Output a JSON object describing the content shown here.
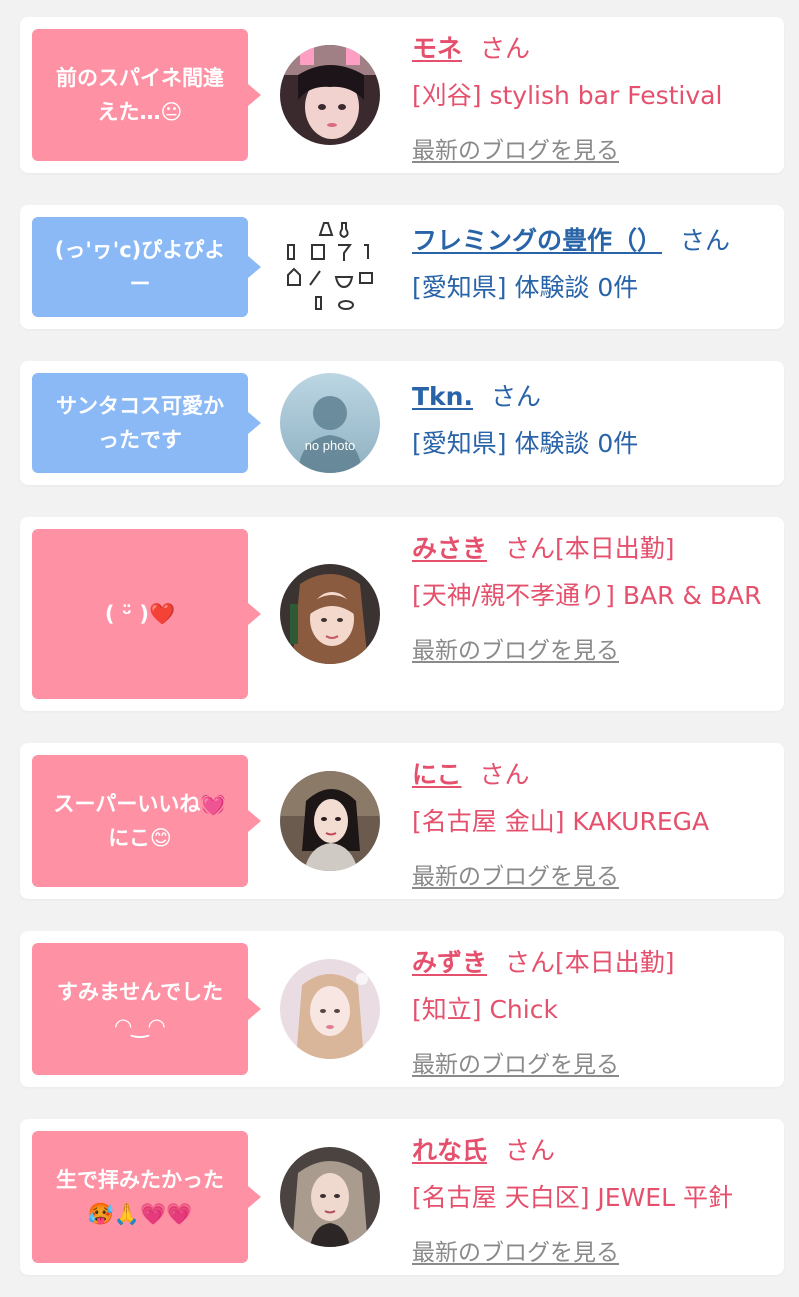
{
  "cards": [
    {
      "bubble_line1": "前のスパイネ間違",
      "bubble_line2": "えた…😐",
      "name": "モネ",
      "suffix": "さん",
      "shop": "[刈谷] stylish bar Festival",
      "blog": "最新のブログを見る"
    },
    {
      "bubble_line1": "(っ'ヮ'c)ぴよぴよ",
      "bubble_line2": "ー",
      "name": "フレミングの豊作（）",
      "suffix": "さん",
      "shop": "[愛知県] 体験談 0件"
    },
    {
      "bubble_line1": "サンタコス可愛か",
      "bubble_line2": "ったです",
      "name": "Tkn.",
      "suffix": "さん",
      "shop": "[愛知県] 体験談 0件",
      "avatar_text": "no photo"
    },
    {
      "bubble_line1": "( ᵕ̈ )❤️",
      "name": "みさき",
      "suffix": "さん[本日出勤]",
      "shop": "[天神/親不孝通り] BAR & BAR",
      "blog": "最新のブログを見る"
    },
    {
      "bubble_line1": "スーパーいいね💓",
      "bubble_line2": "にこ😊",
      "name": "にこ",
      "suffix": "さん",
      "shop": "[名古屋 金山] KAKUREGA",
      "blog": "最新のブログを見る"
    },
    {
      "bubble_line1": "すみませんでした",
      "bubble_line2": "◠‿◠",
      "name": "みずき",
      "suffix": "さん[本日出勤]",
      "shop": "[知立] Chick",
      "blog": "最新のブログを見る"
    },
    {
      "bubble_line1": "生で拝みたかった",
      "bubble_line2": "🥵🙏💗💗",
      "name": "れな氏",
      "suffix": "さん",
      "shop": "[名古屋 天白区] JEWEL 平針",
      "blog": "最新のブログを見る"
    }
  ],
  "colors": {
    "pink_bubble": "#ff91a4",
    "blue_bubble": "#8bb9f5",
    "pink_text": "#e5506d",
    "blue_text": "#2a64a8",
    "link_gray": "#8a8a8a"
  }
}
